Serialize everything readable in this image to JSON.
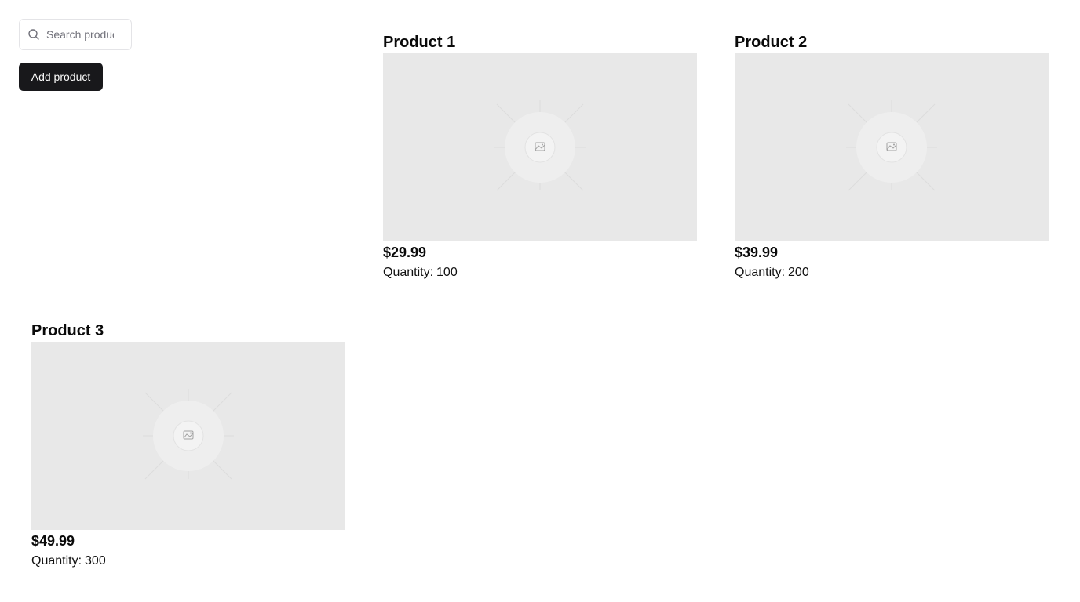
{
  "search": {
    "placeholder": "Search products",
    "icon": "search-icon"
  },
  "toolbar": {
    "add_label": "Add product"
  },
  "products": [
    {
      "title": "Product 1",
      "price": "$29.99",
      "quantity_label": "Quantity:",
      "quantity": "100",
      "image_icon": "image-placeholder-icon"
    },
    {
      "title": "Product 2",
      "price": "$39.99",
      "quantity_label": "Quantity:",
      "quantity": "200",
      "image_icon": "image-placeholder-icon"
    },
    {
      "title": "Product 3",
      "price": "$49.99",
      "quantity_label": "Quantity:",
      "quantity": "300",
      "image_icon": "image-placeholder-icon"
    }
  ],
  "colors": {
    "button_bg": "#18181b",
    "button_text": "#fafafa",
    "placeholder_bg": "#e8e8e8",
    "border": "#e4e4e7"
  }
}
